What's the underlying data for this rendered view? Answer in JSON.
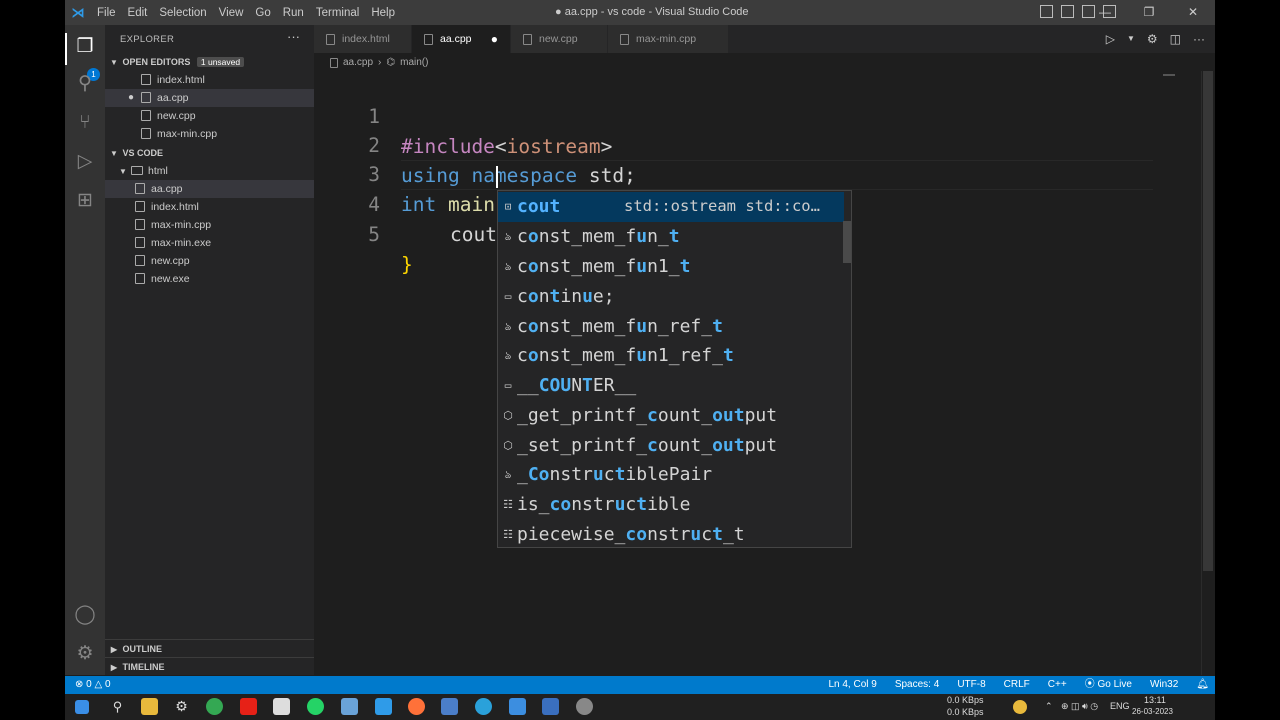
{
  "titlebar": {
    "menu": [
      "File",
      "Edit",
      "Selection",
      "View",
      "Go",
      "Run",
      "Terminal",
      "Help"
    ],
    "window_title": "● aa.cpp - vs code - Visual Studio Code"
  },
  "activity_bar": {
    "explorer_badge": "1"
  },
  "sidebar": {
    "title": "EXPLORER",
    "open_editors_label": "OPEN EDITORS",
    "unsaved_badge": "1 unsaved",
    "open_editors": [
      "index.html",
      "aa.cpp",
      "new.cpp",
      "max-min.cpp"
    ],
    "workspace_label": "VS CODE",
    "folder": "html",
    "files": [
      "aa.cpp",
      "index.html",
      "max-min.cpp",
      "max-min.exe",
      "new.cpp",
      "new.exe"
    ],
    "outline_label": "OUTLINE",
    "timeline_label": "TIMELINE"
  },
  "tabs": [
    {
      "label": "index.html",
      "active": false
    },
    {
      "label": "aa.cpp",
      "active": true,
      "modified": "●"
    },
    {
      "label": "new.cpp",
      "active": false
    },
    {
      "label": "max-min.cpp",
      "active": false
    }
  ],
  "breadcrumb": {
    "file": "aa.cpp",
    "symbol": "main()"
  },
  "editor": {
    "line_numbers": [
      "1",
      "2",
      "3",
      "4",
      "5"
    ],
    "line1": {
      "directive": "#include",
      "lt": "<",
      "header": "iostream",
      "gt": ">"
    },
    "line2": {
      "kw1": "using",
      "kw2": "namespace",
      "rest": " std;"
    },
    "line3": {
      "kw": "int",
      "fn": "main",
      "parens": "()",
      "brace": "{"
    },
    "line4": {
      "typed": "cout"
    },
    "line5": {
      "brace": "}"
    }
  },
  "suggest": {
    "selected_detail": "std::ostream std::co…",
    "items": [
      {
        "kind": "variable",
        "text": "cout"
      },
      {
        "kind": "class",
        "text": "const_mem_fun_t"
      },
      {
        "kind": "class",
        "text": "const_mem_fun1_t"
      },
      {
        "kind": "keyword",
        "text": "continue;"
      },
      {
        "kind": "class",
        "text": "const_mem_fun_ref_t"
      },
      {
        "kind": "class",
        "text": "const_mem_fun1_ref_t"
      },
      {
        "kind": "keyword",
        "text": "__COUNTER__"
      },
      {
        "kind": "method",
        "text": "_get_printf_count_output"
      },
      {
        "kind": "method",
        "text": "_set_printf_count_output"
      },
      {
        "kind": "class",
        "text": "_ConstructiblePair"
      },
      {
        "kind": "struct",
        "text": "is_constructible"
      },
      {
        "kind": "struct",
        "text": "piecewise_construct_t"
      }
    ]
  },
  "statusbar": {
    "errors": "⊗ 0",
    "warnings": "△ 0",
    "position": "Ln 4, Col 9",
    "spaces": "Spaces: 4",
    "encoding": "UTF-8",
    "eol": "CRLF",
    "language": "C++",
    "golive": "Go Live",
    "platform": "Win32"
  },
  "taskbar": {
    "net_up": "0.0 KBps",
    "net_down": "0.0 KBps",
    "lang": "ENG",
    "time": "13:11",
    "date": "26-03-2023"
  },
  "colors": {
    "accent": "#007acc",
    "selection": "#04395e",
    "highlight": "#4fb0f2"
  }
}
